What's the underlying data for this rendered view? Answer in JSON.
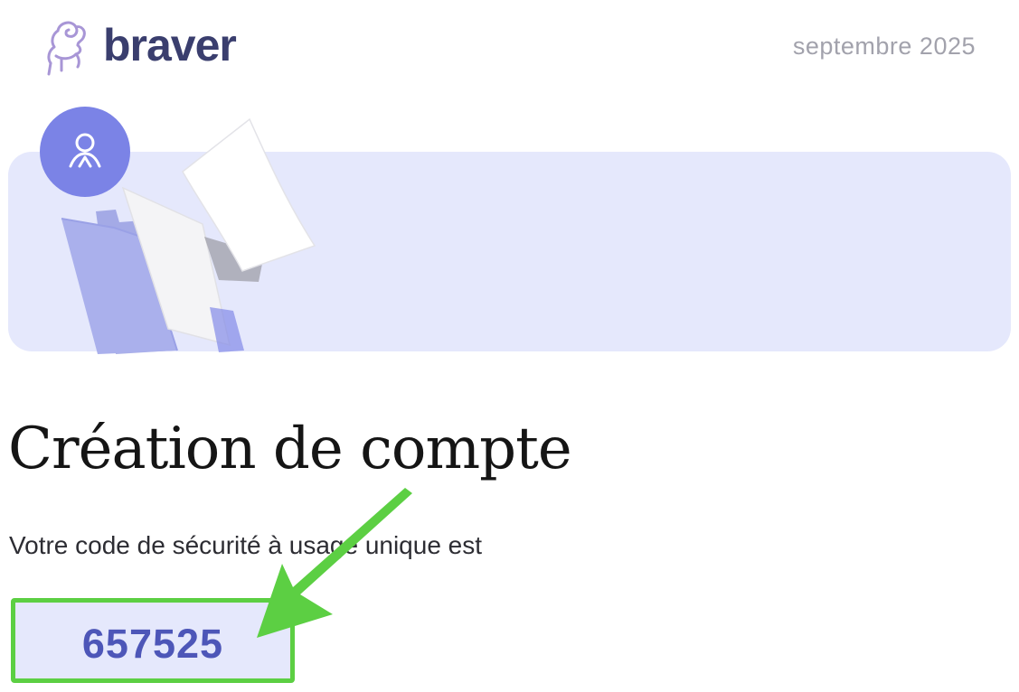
{
  "header": {
    "brand": "braver",
    "date": "septembre 2025"
  },
  "main": {
    "title": "Création de compte",
    "subtitle": "Votre code de sécurité à usage unique est",
    "code": "657525"
  },
  "colors": {
    "brand_text": "#3a3e6e",
    "accent_purple": "#7b83e6",
    "banner_bg": "#e5e8fc",
    "code_text": "#4d56b8",
    "highlight_green": "#5ccf43"
  },
  "icons": [
    "ram-logo-icon",
    "user-icon",
    "folder-documents-illustration",
    "annotation-arrow-icon"
  ]
}
